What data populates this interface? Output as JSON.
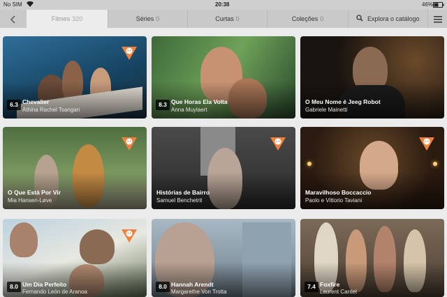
{
  "status_bar": {
    "carrier": "No SIM",
    "time": "20:38",
    "battery": "46%"
  },
  "nav": {
    "back_icon": "chevron-left-icon",
    "tabs": [
      {
        "label": "Filmes",
        "count": "320"
      },
      {
        "label": "Séries",
        "count": "0"
      },
      {
        "label": "Curtas",
        "count": "0"
      },
      {
        "label": "Coleções",
        "count": "0"
      }
    ],
    "search_label": "Explora o catálogo",
    "menu_icon": "hamburger-menu-icon"
  },
  "movies": [
    {
      "title": "Chevalier",
      "subtitle": "Athina Rachel Tsangari",
      "rating": "6.3",
      "badge": true
    },
    {
      "title": "Que Horas Ela Volta",
      "subtitle": "Anna Muylaert",
      "rating": "8.3",
      "badge": false
    },
    {
      "title": "O Meu Nome é Jeeg Robot",
      "subtitle": "Gabriele Mainetti",
      "rating": "",
      "badge": false
    },
    {
      "title": "O Que Está Por Vir",
      "subtitle": "Mia  Hansen-Løve",
      "rating": "",
      "badge": true
    },
    {
      "title": "Histórias de Bairro",
      "subtitle": "Samuel Benchetrit",
      "rating": "",
      "badge": true
    },
    {
      "title": "Maravilhoso Boccaccio",
      "subtitle": "Paolo e Vittorio Taviani",
      "rating": "",
      "badge": true
    },
    {
      "title": "Um Dia Perfeito",
      "subtitle": "Fernando León de Aranoa",
      "rating": "8.0",
      "badge": true
    },
    {
      "title": "Hannah Arendt",
      "subtitle": "Margarethe Von Trotta",
      "rating": "8.0",
      "badge": false
    },
    {
      "title": "Foxfire",
      "subtitle": "Laurent Cantet",
      "rating": "7.4",
      "badge": false
    }
  ],
  "colors": {
    "badge_orange": "#f0813c",
    "nav_bg": "#c9c9c9",
    "active_tab_bg": "#ececec"
  }
}
